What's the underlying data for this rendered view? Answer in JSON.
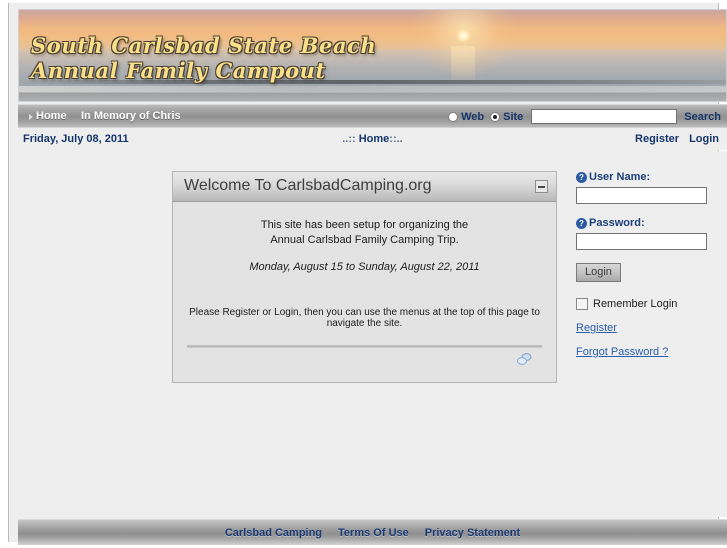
{
  "banner": {
    "title_line1": "South Carlsbad State Beach",
    "title_line2": "Annual Family Campout",
    "photo_alt": "sunset-over-ocean-photo",
    "title_color": "#fbe08a"
  },
  "nav": {
    "items": [
      {
        "label": "Home"
      },
      {
        "label": "In Memory of Chris"
      }
    ],
    "search": {
      "scope_options": [
        "Web",
        "Site"
      ],
      "web_label": "Web",
      "site_label": "Site",
      "selected_scope": "Site",
      "input_value": "",
      "placeholder": "",
      "search_label": "Search"
    }
  },
  "subheader": {
    "date": "Friday, July 08, 2011",
    "breadcrumb_prefix": "..:: ",
    "breadcrumb_current": "Home",
    "breadcrumb_suffix": "::..",
    "register_label": "Register",
    "login_label": "Login"
  },
  "content_panel": {
    "title": "Welcome To CarlsbadCamping.org",
    "minimize_icon": "minus-icon",
    "line1": "This site has been setup for organizing the",
    "line2": "Annual Carlsbad Family Camping Trip.",
    "dates": "Monday, August 15 to Sunday, August 22, 2011",
    "note": "Please Register or Login, then you can use the menus at the top of this page to navigate the site.",
    "share_icon": "link-share-icon"
  },
  "login_panel": {
    "username_label": "User Name:",
    "username_value": "",
    "username_help_icon": "help-question-icon",
    "password_label": "Password:",
    "password_value": "",
    "password_help_icon": "help-question-icon",
    "login_button": "Login",
    "remember_label": "Remember Login",
    "remember_checked": false,
    "register_link": "Register",
    "forgot_link": "Forgot Password ?"
  },
  "footer": {
    "links": [
      {
        "label": "Carlsbad Camping"
      },
      {
        "label": "Terms Of Use"
      },
      {
        "label": "Privacy Statement"
      }
    ]
  }
}
